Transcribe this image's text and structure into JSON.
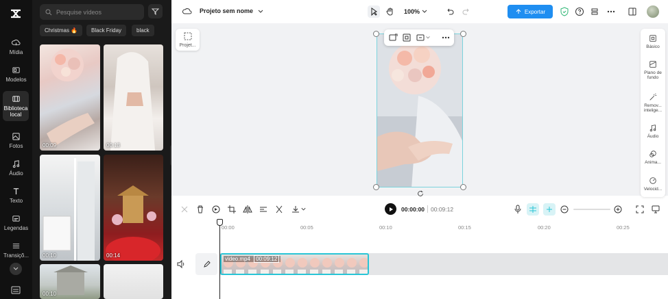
{
  "nav": {
    "items": [
      {
        "label": "Mídia",
        "icon": "cloud-upload-icon"
      },
      {
        "label": "Modelos",
        "icon": "template-icon"
      },
      {
        "label": "Biblioteca local",
        "icon": "library-icon"
      },
      {
        "label": "Fotos",
        "icon": "photo-icon"
      },
      {
        "label": "Áudio",
        "icon": "music-icon"
      },
      {
        "label": "Texto",
        "icon": "text-icon"
      },
      {
        "label": "Legendas",
        "icon": "captions-icon"
      },
      {
        "label": "Transiçõ...",
        "icon": "transition-icon"
      }
    ]
  },
  "panel": {
    "search_placeholder": "Pesquise vídeos",
    "chips": [
      "Christmas 🔥",
      "Black Friday",
      "black"
    ],
    "thumbs": [
      {
        "duration": "00:09"
      },
      {
        "duration": "00:13"
      },
      {
        "duration": "00:10"
      },
      {
        "duration": "00:14"
      },
      {
        "duration": "00:10"
      },
      {
        "duration": ""
      }
    ]
  },
  "topbar": {
    "project_name": "Projeto sem nome",
    "zoom": "100%",
    "export_label": "Exportar"
  },
  "canvas": {
    "project_card_label": "Projet..."
  },
  "rightpanel": {
    "items": [
      {
        "label": "Básico",
        "icon": "basic-icon"
      },
      {
        "label": "Plano de fundo",
        "icon": "background-icon"
      },
      {
        "label": "Remov... intelige...",
        "icon": "magic-wand-icon"
      },
      {
        "label": "Áudio",
        "icon": "music-icon"
      },
      {
        "label": "Anima...",
        "icon": "animation-icon"
      },
      {
        "label": "Velocid...",
        "icon": "speed-icon"
      }
    ]
  },
  "timeline": {
    "current_time": "00:00:00",
    "total_time": "00:09:12",
    "ruler_ticks": [
      "00:00",
      "00:05",
      "00:10",
      "00:15",
      "00:20",
      "00:25"
    ],
    "clip_label": "video.mp4",
    "clip_duration": "00:09:12"
  },
  "colors": {
    "accent": "#1f8ef1",
    "clip_border": "#29c5d6"
  }
}
